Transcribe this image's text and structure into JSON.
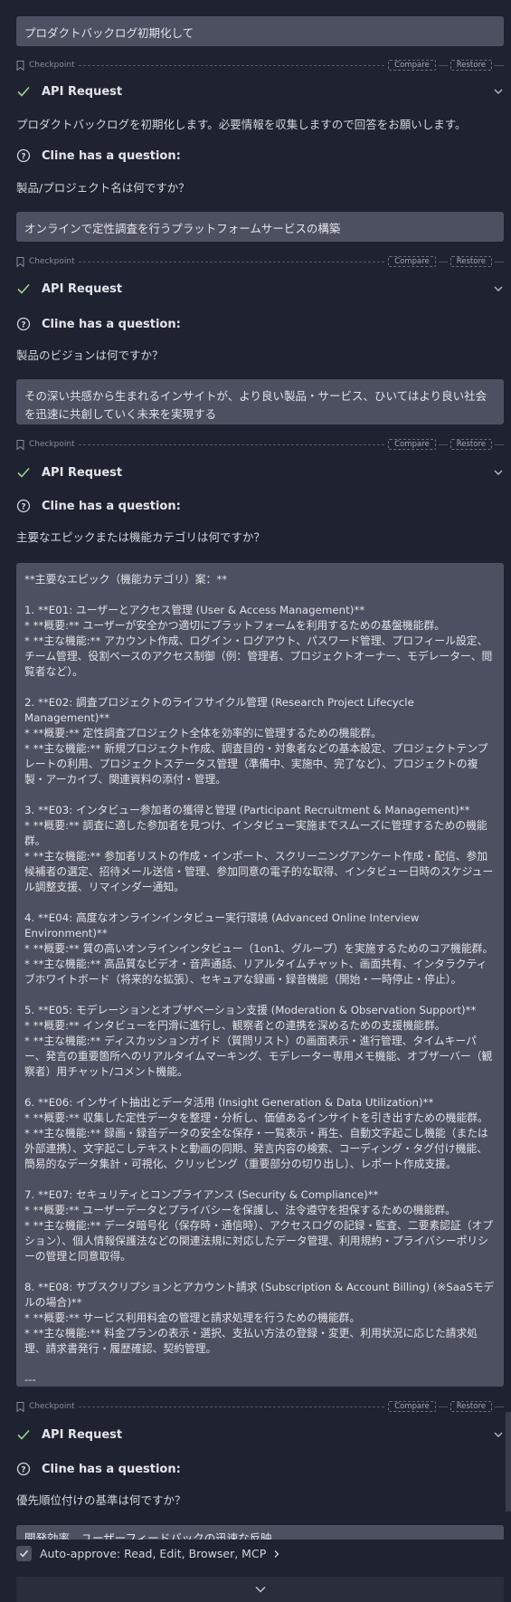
{
  "messages": {
    "user1": "プロダクトバックログ初期化して",
    "user2": "オンラインで定性調査を行うプラットフォームサービスの構築",
    "user3": "その深い共感から生まれるインサイトが、より良い製品・サービス、ひいてはより良い社会を迅速に共創していく未来を実現する",
    "user4": "**主要なエピック（機能カテゴリ）案：**\n\n1. **E01: ユーザーとアクセス管理 (User & Access Management)**\n* **概要:** ユーザーが安全かつ適切にプラットフォームを利用するための基盤機能群。\n* **主な機能:** アカウント作成、ログイン・ログアウト、パスワード管理、プロフィール設定、チーム管理、役割ベースのアクセス制御（例：管理者、プロジェクトオーナー、モデレーター、閲覧者など）。\n\n2. **E02: 調査プロジェクトのライフサイクル管理 (Research Project Lifecycle Management)**\n* **概要:** 定性調査プロジェクト全体を効率的に管理するための機能群。\n* **主な機能:** 新規プロジェクト作成、調査目的・対象者などの基本設定、プロジェクトテンプレートの利用、プロジェクトステータス管理（準備中、実施中、完了など）、プロジェクトの複製・アーカイブ、関連資料の添付・管理。\n\n3. **E03: インタビュー参加者の獲得と管理 (Participant Recruitment & Management)**\n* **概要:** 調査に適した参加者を見つけ、インタビュー実施までスムーズに管理するための機能群。\n* **主な機能:** 参加者リストの作成・インポート、スクリーニングアンケート作成・配信、参加候補者の選定、招待メール送信・管理、参加同意の電子的な取得、インタビュー日時のスケジュール調整支援、リマインダー通知。\n\n4. **E04: 高度なオンラインインタビュー実行環境 (Advanced Online Interview Environment)**\n* **概要:** 質の高いオンラインインタビュー（1on1、グループ）を実施するためのコア機能群。\n* **主な機能:** 高品質なビデオ・音声通話、リアルタイムチャット、画面共有、インタラクティブホワイトボード（将来的な拡張）、セキュアな録画・録音機能（開始・一時停止・停止）。\n\n5. **E05: モデレーションとオブザベーション支援 (Moderation & Observation Support)**\n* **概要:** インタビューを円滑に進行し、観察者との連携を深めるための支援機能群。\n* **主な機能:** ディスカッションガイド（質問リスト）の画面表示・進行管理、タイムキーパー、発言の重要箇所へのリアルタイムマーキング、モデレーター専用メモ機能、オブザーバー（観察者）用チャット/コメント機能。\n\n6. **E06: インサイト抽出とデータ活用 (Insight Generation & Data Utilization)**\n* **概要:** 収集した定性データを整理・分析し、価値あるインサイトを引き出すための機能群。\n* **主な機能:** 録画・録音データの安全な保存・一覧表示・再生、自動文字起こし機能（または外部連携）、文字起こしテキストと動画の同期、発言内容の検索、コーディング・タグ付け機能、簡易的なデータ集計・可視化、クリッピング（重要部分の切り出し）、レポート作成支援。\n\n7. **E07: セキュリティとコンプライアンス (Security & Compliance)**\n* **概要:** ユーザーデータとプライバシーを保護し、法令遵守を担保するための機能群。\n* **主な機能:** データ暗号化（保存時・通信時）、アクセスログの記録・監査、二要素認証（オプション）、個人情報保護法などの関連法規に対応したデータ管理、利用規約・プライバシーポリシーの管理と同意取得。\n\n8. **E08: サブスクリプションとアカウント請求 (Subscription & Account Billing) (※SaaSモデルの場合)**\n* **概要:** サービス利用料金の管理と請求処理を行うための機能群。\n* **主な機能:** 料金プランの表示・選択、支払い方法の登録・変更、利用状況に応じた請求処理、請求書発行・履歴確認、契約管理。\n\n---",
    "user5": "開発効率、ユーザーフィードバックの迅速な反映"
  },
  "checkpoint": {
    "label": "Checkpoint",
    "compare": "Compare",
    "restore": "Restore"
  },
  "api_request": "API Request",
  "cline_question": "Cline has a question:",
  "assistant": {
    "intro": "プロダクトバックログを初期化します。必要情報を収集しますので回答をお願いします。",
    "q1": "製品/プロジェクト名は何ですか？",
    "q2": "製品のビジョンは何ですか？",
    "q3": "主要なエピックまたは機能カテゴリは何ですか？",
    "q4": "優先順位付けの基準は何ですか？"
  },
  "auto_approve": "Auto-approve: Read, Edit, Browser, MCP",
  "colors": {
    "background": "#1f2230",
    "bubble": "#4d5061",
    "check": "#9fd38a"
  }
}
